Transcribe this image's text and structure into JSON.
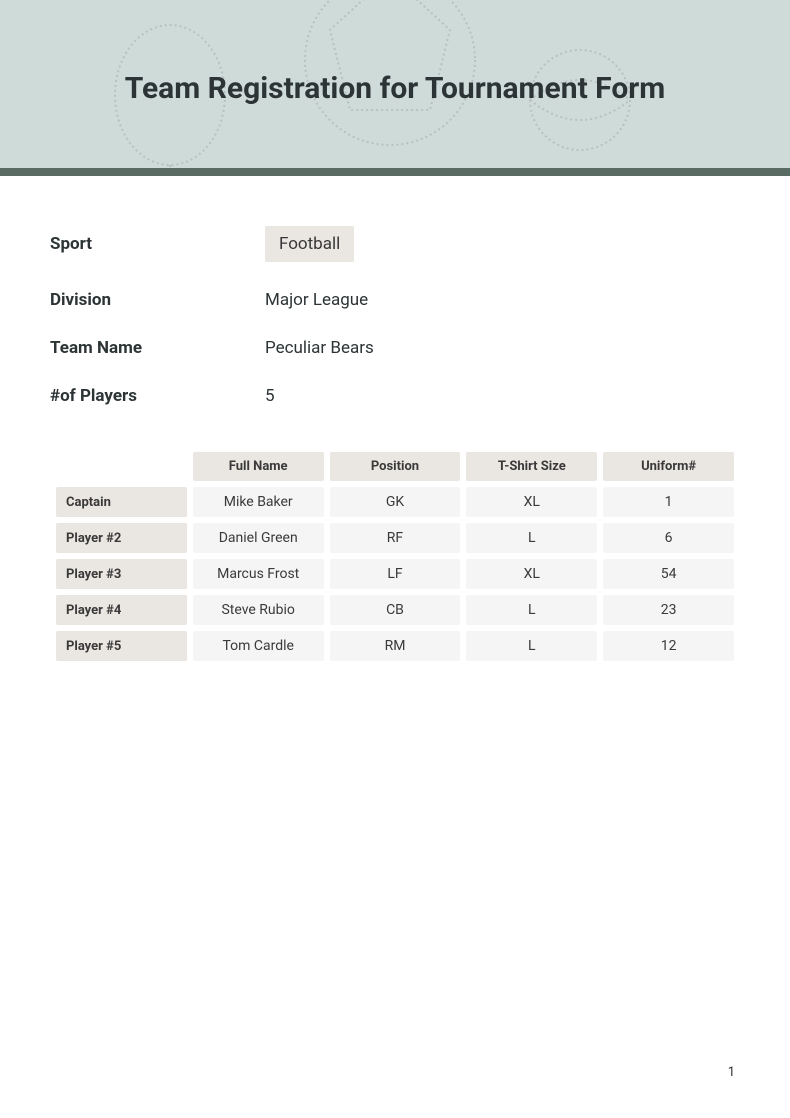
{
  "header": {
    "title": "Team Registration for Tournament Form"
  },
  "fields": {
    "sport_label": "Sport",
    "sport_value": "Football",
    "division_label": "Division",
    "division_value": "Major League",
    "team_name_label": "Team Name",
    "team_name_value": "Peculiar Bears",
    "players_count_label": "#of Players",
    "players_count_value": "5"
  },
  "table": {
    "headers": {
      "full_name": "Full Name",
      "position": "Position",
      "tshirt_size": "T-Shirt Size",
      "uniform": "Uniform#"
    },
    "rows": [
      {
        "label": "Captain",
        "full_name": "Mike Baker",
        "position": "GK",
        "tshirt_size": "XL",
        "uniform": "1"
      },
      {
        "label": "Player #2",
        "full_name": "Daniel Green",
        "position": "RF",
        "tshirt_size": "L",
        "uniform": "6"
      },
      {
        "label": "Player #3",
        "full_name": "Marcus Frost",
        "position": "LF",
        "tshirt_size": "XL",
        "uniform": "54"
      },
      {
        "label": "Player #4",
        "full_name": "Steve Rubio",
        "position": "CB",
        "tshirt_size": "L",
        "uniform": "23"
      },
      {
        "label": "Player #5",
        "full_name": "Tom Cardle",
        "position": "RM",
        "tshirt_size": "L",
        "uniform": "12"
      }
    ]
  },
  "page_number": "1"
}
